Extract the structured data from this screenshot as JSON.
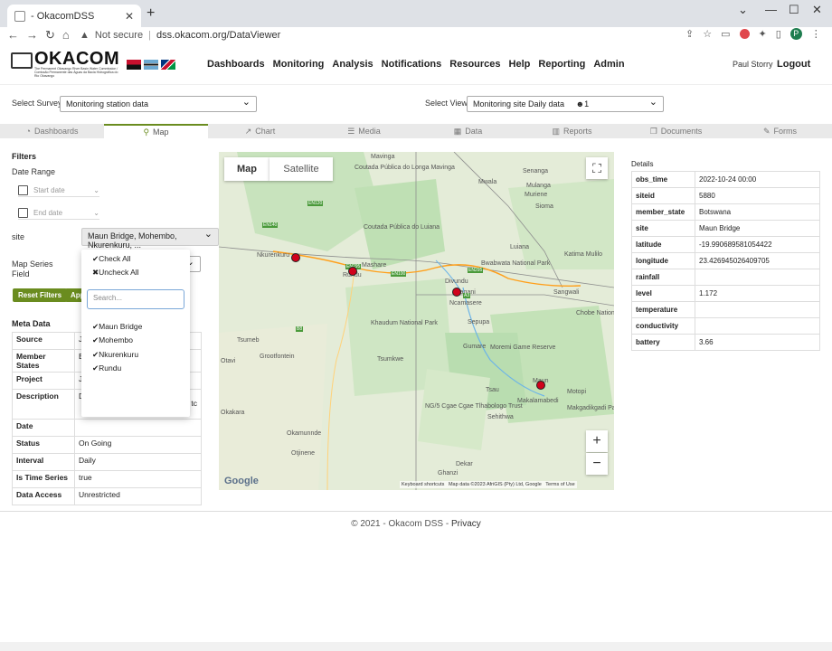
{
  "browser": {
    "tab_title": "- OkacomDSS",
    "not_secure": "Not secure",
    "url": "dss.okacom.org/DataViewer",
    "profile_initial": "P"
  },
  "site": {
    "logo_text": "OKACOM",
    "logo_sub": "The Permanent Okavango River Basin Water Commission / Comissão Permanente das Águas da Bacia Hidrográfica do Rio Okavango",
    "nav": [
      "Dashboards",
      "Monitoring",
      "Analysis",
      "Notifications",
      "Resources",
      "Help",
      "Reporting",
      "Admin"
    ],
    "user": "Paul Storry",
    "logout": "Logout"
  },
  "survey": {
    "label": "Select Survey:",
    "value": "Monitoring station data",
    "view_label": "Select View:",
    "view_value": "Monitoring site Daily data",
    "view_count": "1"
  },
  "tabs": [
    "Dashboards",
    "Map",
    "Chart",
    "Media",
    "Data",
    "Reports",
    "Documents",
    "Forms"
  ],
  "filters": {
    "title": "Filters",
    "date_range": "Date Range",
    "start_placeholder": "Start date",
    "end_placeholder": "End date",
    "site_label": "site",
    "site_value": "Maun Bridge, Mohembo, Nkurenkuru, ...",
    "map_series_label": "Map Series",
    "field_label": "Field",
    "reset_btn": "Reset Filters",
    "apply_btn": "App"
  },
  "dropdown": {
    "check_all": "Check All",
    "uncheck_all": "Uncheck All",
    "search_placeholder": "Search...",
    "options": [
      "Maun Bridge",
      "Mohembo",
      "Nkurenkuru",
      "Rundu"
    ]
  },
  "meta": {
    "title": "Meta Data",
    "rows": [
      {
        "k": "Source",
        "v": "J"
      },
      {
        "k": "Member States",
        "v": "E"
      },
      {
        "k": "Project",
        "v": "J"
      },
      {
        "k": "Description",
        "v": "D"
      },
      {
        "k": "Date",
        "v": ""
      },
      {
        "k": "Status",
        "v": "On Going"
      },
      {
        "k": "Interval",
        "v": "Daily"
      },
      {
        "k": "Is Time Series",
        "v": "true"
      },
      {
        "k": "Data Access",
        "v": "Unrestricted"
      }
    ],
    "desc_extra": "tc"
  },
  "map": {
    "btn_map": "Map",
    "btn_satellite": "Satellite",
    "zoom_in": "+",
    "zoom_out": "−",
    "google": "Google",
    "attribution": "Keyboard shortcuts   Map data ©2023 AfriGIS (Pty) Ltd, Google   Terms of Use",
    "labels": [
      {
        "t": "Mavinga"
      },
      {
        "t": "Coutada Pública do Longa Mavinga"
      },
      {
        "t": "Mwala"
      },
      {
        "t": "Senanga"
      },
      {
        "t": "Mulanga"
      },
      {
        "t": "Muriene"
      },
      {
        "t": "Sioma"
      },
      {
        "t": "Coutada Pública do Luiana"
      },
      {
        "t": "Nkurenkuru"
      },
      {
        "t": "Mashare"
      },
      {
        "t": "Rundu"
      },
      {
        "t": "Divundu"
      },
      {
        "t": "Bagani"
      },
      {
        "t": "Ncamasere"
      },
      {
        "t": "Luiana"
      },
      {
        "t": "Katima Mulilo"
      },
      {
        "t": "Sangwali"
      },
      {
        "t": "Bwabwata National Park"
      },
      {
        "t": "Chobe National Park"
      },
      {
        "t": "Khaudum National Park"
      },
      {
        "t": "Sepupa"
      },
      {
        "t": "Tsumeb"
      },
      {
        "t": "Grootfontein"
      },
      {
        "t": "Otavi"
      },
      {
        "t": "Tsumkwe"
      },
      {
        "t": "Gumare"
      },
      {
        "t": "Moremi Game Reserve"
      },
      {
        "t": "Maun"
      },
      {
        "t": "Tsau"
      },
      {
        "t": "Makalamabedi"
      },
      {
        "t": "Motopi"
      },
      {
        "t": "Makgadikgadi Pans National Park"
      },
      {
        "t": "NG/5 Cgae Cgae Tlhabologo Trust"
      },
      {
        "t": "Sehithwa"
      },
      {
        "t": "Okakara"
      },
      {
        "t": "Okamunnde"
      },
      {
        "t": "Otjinene"
      },
      {
        "t": "Dekar"
      },
      {
        "t": "Ghanzi"
      }
    ],
    "roads": [
      "EN140",
      "EN120",
      "EN295",
      "EN100",
      "B8",
      "A3",
      "EN295"
    ]
  },
  "details": {
    "title": "Details",
    "rows": [
      {
        "k": "obs_time",
        "v": "2022-10-24 00:00"
      },
      {
        "k": "siteid",
        "v": "5880"
      },
      {
        "k": "member_state",
        "v": "Botswana"
      },
      {
        "k": "site",
        "v": "Maun Bridge"
      },
      {
        "k": "latitude",
        "v": "-19.990689581054422"
      },
      {
        "k": "longitude",
        "v": "23.426945026409705"
      },
      {
        "k": "rainfall",
        "v": ""
      },
      {
        "k": "level",
        "v": "1.172"
      },
      {
        "k": "temperature",
        "v": ""
      },
      {
        "k": "conductivity",
        "v": ""
      },
      {
        "k": "battery",
        "v": "3.66"
      }
    ]
  },
  "footer": {
    "copyright": "© 2021 - Okacom DSS - ",
    "privacy": "Privacy"
  },
  "colors": {
    "accent": "#6a8c1f",
    "marker": "#d0021b"
  }
}
